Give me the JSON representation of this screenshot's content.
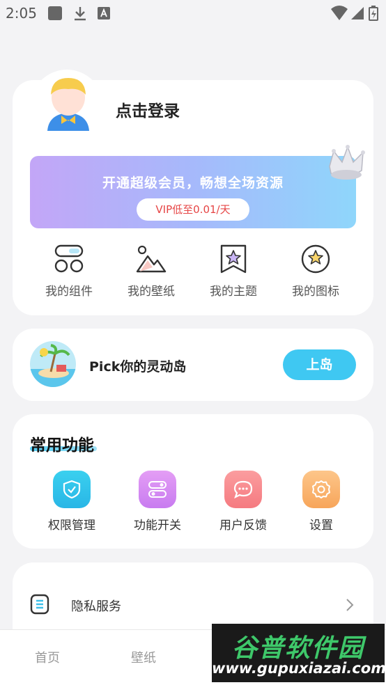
{
  "status_bar": {
    "time": "2:05"
  },
  "profile": {
    "login_label": "点击登录"
  },
  "vip": {
    "title": "开通超级会员，畅想全场资源",
    "button_label": "VIP低至0.01/天"
  },
  "quick_actions": [
    {
      "label": "我的组件",
      "icon": "widgets-icon"
    },
    {
      "label": "我的壁纸",
      "icon": "wallpaper-icon"
    },
    {
      "label": "我的主题",
      "icon": "theme-icon"
    },
    {
      "label": "我的图标",
      "icon": "icon-pack-icon"
    }
  ],
  "island": {
    "text": "Pick你的灵动岛",
    "button_label": "上岛"
  },
  "common_functions": {
    "title": "常用功能",
    "items": [
      {
        "label": "权限管理",
        "icon": "shield-icon",
        "color_from": "#3ad0ef",
        "color_to": "#29b6e6"
      },
      {
        "label": "功能开关",
        "icon": "toggle-icon",
        "color_from": "#e49ef5",
        "color_to": "#c87bf0"
      },
      {
        "label": "用户反馈",
        "icon": "chat-bubble-icon",
        "color_from": "#fb9d9f",
        "color_to": "#f57a80"
      },
      {
        "label": "设置",
        "icon": "gear-icon",
        "color_from": "#fdc68a",
        "color_to": "#f7a55a"
      }
    ]
  },
  "menu": {
    "privacy_label": "隐私服务"
  },
  "bottom_nav": {
    "home": "首页",
    "wallpaper": "壁纸"
  },
  "watermark": {
    "title": "谷普软件园",
    "url": "www.gupuxiazai.com"
  }
}
